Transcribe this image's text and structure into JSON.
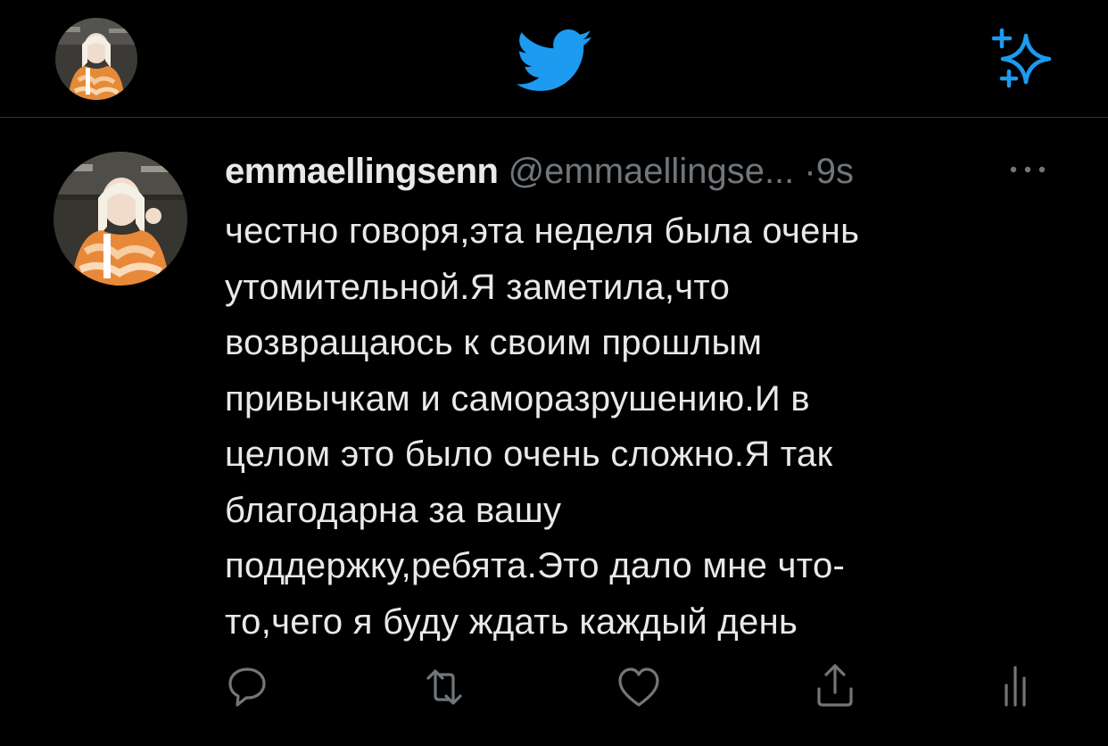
{
  "topbar": {
    "profile_avatar": "user-avatar-photo",
    "logo_icon": "twitter-bird-icon",
    "top_tweets_icon": "sparkle-icon"
  },
  "tweet": {
    "display_name": "emmaellingsenn",
    "handle": "@emmaellingse...",
    "separator": "·",
    "time": "9s",
    "text": "честно говоря,эта неделя была очень\nутомительной.Я заметила,что\nвозвращаюсь к своим прошлым\nпривычкам и саморазрушению.И в\nцелом это было очень сложно.Я так\nблагодарна за вашу\nподдержку,ребята.Это дало мне что-\nто,чего я буду ждать каждый день"
  },
  "actions": {
    "reply_icon": "reply-icon",
    "retweet_icon": "retweet-icon",
    "like_icon": "heart-icon",
    "share_icon": "share-icon",
    "analytics_icon": "analytics-icon"
  },
  "colors": {
    "background": "#000000",
    "primary_text": "#e7e9ea",
    "secondary_text": "#71767b",
    "brand_blue": "#1d9bf0",
    "divider": "#2f3336"
  }
}
